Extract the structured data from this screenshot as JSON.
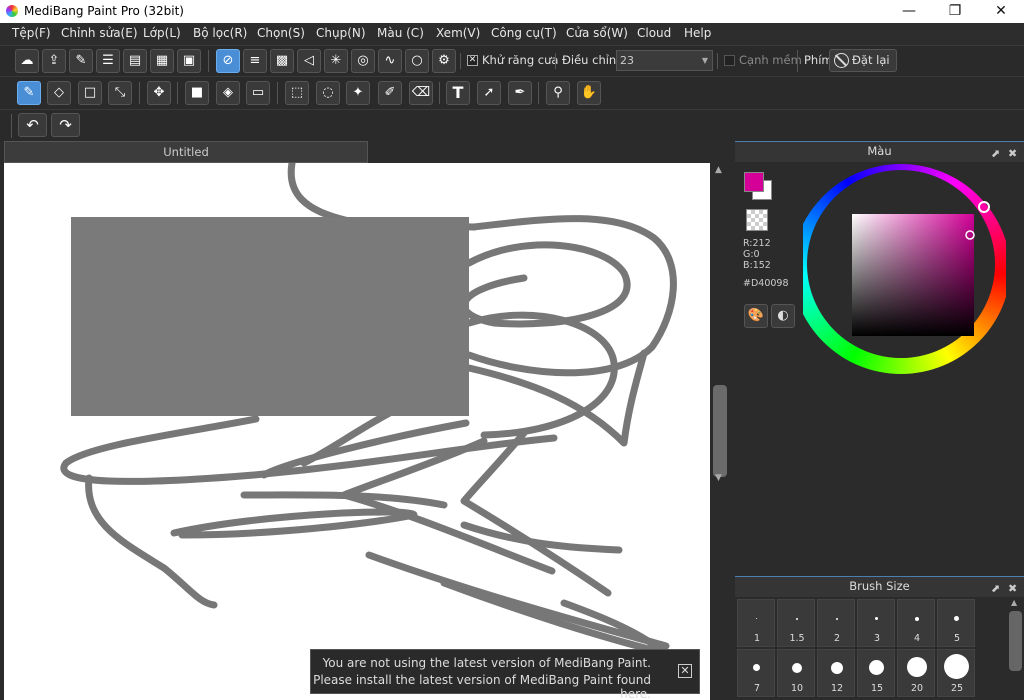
{
  "window": {
    "title": "MediBang Paint Pro (32bit)"
  },
  "window_controls": {
    "minimize": "—",
    "restore": "❐",
    "close": "✕"
  },
  "menu": [
    "Tệp(F)",
    "Chỉnh sửa(E)",
    "Lớp(L)",
    "Bộ lọc(R)",
    "Chọn(S)",
    "Chụp(N)",
    "Màu (C)",
    "Xem(V)",
    "Công cụ(T)",
    "Cửa sổ(W)",
    "Cloud",
    "Help"
  ],
  "toolbar1": {
    "antialias_label": "Khử răng cưa",
    "antialias_mark": "✕",
    "correction_label": "Điều chỉnh",
    "correction_value": "23",
    "smooth_label": "Cạnh mềm",
    "key_label": "Phím",
    "reset_label": "Đặt lại"
  },
  "document": {
    "tab_title": "Untitled"
  },
  "color_panel": {
    "title": "Màu",
    "foreground": "#D40098",
    "r": "R:212",
    "g": "G:0",
    "b": "B:152",
    "hex": "#D40098"
  },
  "brush_panel": {
    "title": "Brush Size",
    "sizes": [
      "1",
      "1.5",
      "2",
      "3",
      "4",
      "5",
      "7",
      "10",
      "12",
      "15",
      "20",
      "25"
    ]
  },
  "notice": {
    "line1": "You are not using the latest version of MediBang Paint.",
    "line2": "Please install the latest version of MediBang Paint found here."
  },
  "panel_buttons": {
    "popout": "⬈",
    "close": "✖"
  }
}
